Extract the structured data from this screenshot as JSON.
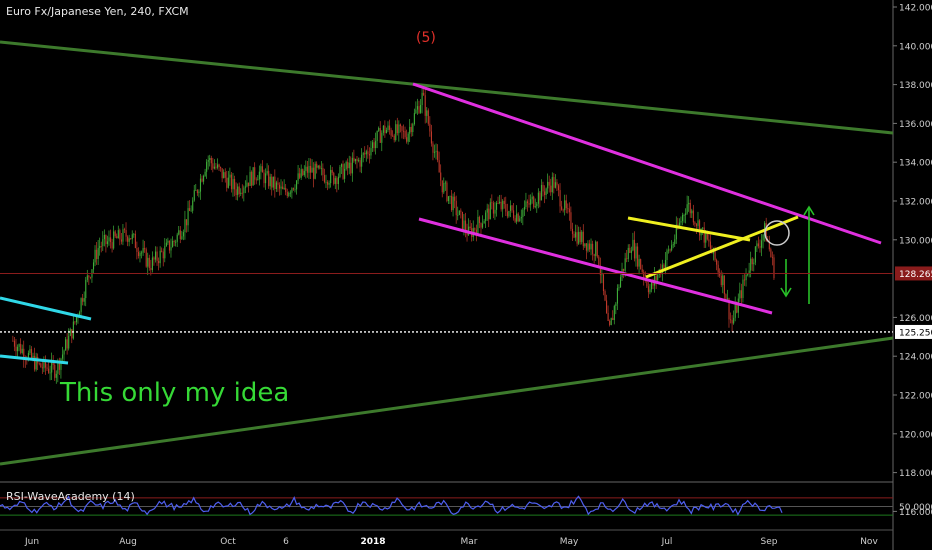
{
  "header": {
    "title": "Euro Fx/Japanese Yen, 240, FXCM"
  },
  "annotations": {
    "wave_label": "(5)",
    "note": "This only my idea"
  },
  "colors": {
    "background": "#000000",
    "candle": "#a0a030",
    "channel": "#e030e0",
    "trend": "#3d7a2c",
    "triangle": "#f0f020",
    "cyan": "#30d8e8",
    "arrow": "#28c028",
    "price_line": "#8a1c1c",
    "rsi_line": "#4f5ff0"
  },
  "chart_data": [
    {
      "type": "candlestick",
      "title": "Euro Fx/Japanese Yen, 240, FXCM",
      "x_tick_labels": [
        "Jun",
        "Aug",
        "Oct",
        "6",
        "2018",
        "Mar",
        "May",
        "Jul",
        "Sep",
        "Nov"
      ],
      "y_tick_labels": [
        "142.000",
        "140.000",
        "138.000",
        "136.000",
        "134.000",
        "132.000",
        "130.000",
        "128.265",
        "126.000",
        "125.250",
        "124.000",
        "122.000",
        "120.000",
        "118.000",
        "116.000"
      ],
      "ylim": [
        115.3,
        142.0
      ],
      "current_price": "128.265",
      "support_level": "125.250",
      "price_path": [
        {
          "date": "2017-05-20",
          "close": 124.8
        },
        {
          "date": "2017-06-05",
          "close": 123.5
        },
        {
          "date": "2017-06-16",
          "close": 123.3
        },
        {
          "date": "2017-06-27",
          "close": 125.5
        },
        {
          "date": "2017-07-05",
          "close": 127.8
        },
        {
          "date": "2017-07-13",
          "close": 129.7
        },
        {
          "date": "2017-08-01",
          "close": 130.3
        },
        {
          "date": "2017-08-14",
          "close": 128.7
        },
        {
          "date": "2017-08-29",
          "close": 129.9
        },
        {
          "date": "2017-09-07",
          "close": 131.2
        },
        {
          "date": "2017-09-19",
          "close": 134.2
        },
        {
          "date": "2017-10-07",
          "close": 132.6
        },
        {
          "date": "2017-10-21",
          "close": 133.5
        },
        {
          "date": "2017-11-06",
          "close": 132.4
        },
        {
          "date": "2017-11-21",
          "close": 133.6
        },
        {
          "date": "2017-12-07",
          "close": 133.2
        },
        {
          "date": "2017-12-24",
          "close": 134.1
        },
        {
          "date": "2018-01-08",
          "close": 135.7
        },
        {
          "date": "2018-01-22",
          "close": 135.4
        },
        {
          "date": "2018-02-01",
          "close": 137.4
        },
        {
          "date": "2018-02-13",
          "close": 132.9
        },
        {
          "date": "2018-03-02",
          "close": 130.3
        },
        {
          "date": "2018-03-19",
          "close": 131.8
        },
        {
          "date": "2018-04-02",
          "close": 131.3
        },
        {
          "date": "2018-04-24",
          "close": 133.0
        },
        {
          "date": "2018-05-08",
          "close": 130.3
        },
        {
          "date": "2018-05-22",
          "close": 129.4
        },
        {
          "date": "2018-05-29",
          "close": 125.1
        },
        {
          "date": "2018-06-05",
          "close": 128.0
        },
        {
          "date": "2018-06-12",
          "close": 129.9
        },
        {
          "date": "2018-06-24",
          "close": 127.4
        },
        {
          "date": "2018-07-08",
          "close": 129.8
        },
        {
          "date": "2018-07-17",
          "close": 131.9
        },
        {
          "date": "2018-07-31",
          "close": 129.7
        },
        {
          "date": "2018-08-09",
          "close": 127.8
        },
        {
          "date": "2018-08-14",
          "close": 125.6
        },
        {
          "date": "2018-08-25",
          "close": 128.7
        },
        {
          "date": "2018-09-04",
          "close": 130.5
        },
        {
          "date": "2018-09-10",
          "close": 128.3
        }
      ]
    },
    {
      "type": "line",
      "title": "RSI-WaveAcademy (14)",
      "y_tick_labels": [
        "50.0000"
      ],
      "ylim": [
        0,
        100
      ],
      "levels": [
        30,
        50,
        70
      ],
      "series": [
        {
          "values": [
            52,
            44,
            61,
            38,
            55,
            47,
            70,
            33,
            58,
            49,
            64,
            41,
            56,
            36,
            60,
            52,
            45,
            67,
            39,
            55,
            48,
            62,
            35,
            57,
            50,
            43,
            66,
            40,
            54,
            46,
            59,
            37,
            63,
            51,
            44,
            69,
            42,
            53,
            47,
            61,
            34,
            56,
            49,
            65,
            38,
            52,
            45,
            60,
            41,
            57,
            48,
            71,
            36,
            55,
            43,
            62,
            39,
            58,
            50,
            46,
            64,
            40,
            53,
            47,
            59,
            35,
            66,
            44,
            51,
            42
          ]
        }
      ]
    }
  ]
}
